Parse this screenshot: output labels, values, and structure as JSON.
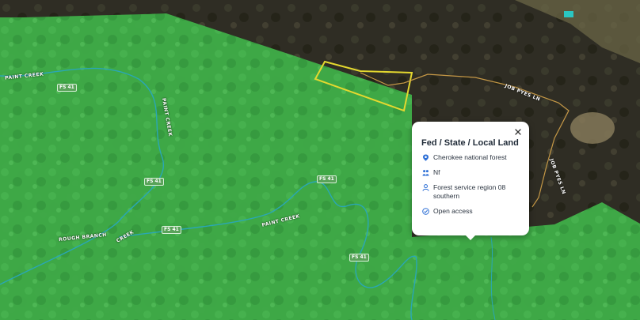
{
  "map": {
    "road_labels": {
      "paint_creek_w": "PAINT CREEK",
      "paint_creek_n": "PAINT CREEK",
      "paint_creek_s": "PAINT CREEK",
      "rough_branch": "ROUGH BRANCH",
      "creek": "CREEK",
      "job_pyes": "JOB PYES LN",
      "jp_lower": "JOB PYES LN"
    },
    "shields": {
      "fs41_a": "FS 41",
      "fs41_b": "FS 41",
      "fs41_c": "FS 41",
      "fs41_d": "FS 41",
      "fs41_e": "FS 41"
    },
    "colors": {
      "forest_overlay": "#3fb24a",
      "boundary": "#e4d82f",
      "water": "#2aa7b5",
      "road": "#d6a44a"
    }
  },
  "popup": {
    "title": "Fed / State / Local Land",
    "items": [
      {
        "icon": "shield-pin-icon",
        "text": "Cherokee national forest"
      },
      {
        "icon": "people-icon",
        "text": "Nf"
      },
      {
        "icon": "agent-icon",
        "text": "Forest service region 08 southern"
      },
      {
        "icon": "check-circle-icon",
        "text": "Open access"
      }
    ],
    "accent_color": "#2d6fd6"
  }
}
